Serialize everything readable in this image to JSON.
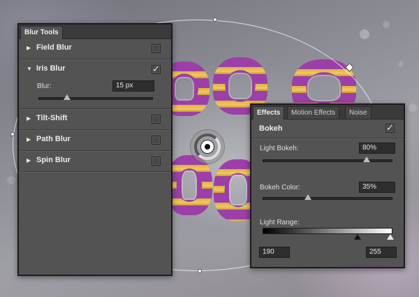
{
  "blur_tools": {
    "tab_label": "Blur Tools",
    "items": [
      {
        "label": "Field Blur",
        "checked": false,
        "expanded": false
      },
      {
        "label": "Iris Blur",
        "checked": true,
        "expanded": true
      },
      {
        "label": "Tilt-Shift",
        "checked": false,
        "expanded": false
      },
      {
        "label": "Path Blur",
        "checked": false,
        "expanded": false
      },
      {
        "label": "Spin Blur",
        "checked": false,
        "expanded": false
      }
    ],
    "iris": {
      "blur_label": "Blur:",
      "blur_value": "15 px",
      "blur_level": 0.25
    }
  },
  "effects": {
    "tabs": [
      {
        "label": "Effects",
        "active": true
      },
      {
        "label": "Motion Effects",
        "active": false
      },
      {
        "label": "Noise",
        "active": false
      }
    ],
    "bokeh": {
      "label": "Bokeh",
      "checked": true,
      "light_bokeh_label": "Light Bokeh:",
      "light_bokeh_value": "80%",
      "light_bokeh_level": 0.8,
      "bokeh_color_label": "Bokeh Color:",
      "bokeh_color_value": "35%",
      "bokeh_color_level": 0.35,
      "light_range_label": "Light Range:",
      "light_range_low": "190",
      "light_range_high": "255"
    }
  },
  "icons": {
    "expanded": "▼",
    "collapsed": "▶",
    "check": "✓"
  },
  "colors": {
    "panel_bg": "#535353",
    "tab_bar": "#3a3a3a",
    "letter_fill": "#9c3fa8",
    "stripe": "#e2b73a"
  }
}
